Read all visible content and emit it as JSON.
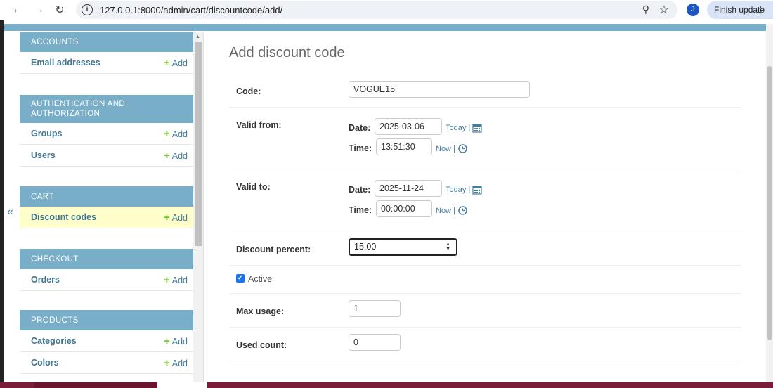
{
  "browser": {
    "url": "127.0.0.1:8000/admin/cart/discountcode/add/",
    "avatar_letter": "J",
    "finish_update_label": "Finish update"
  },
  "sidebar": {
    "toggle_label": "«",
    "modules": [
      {
        "name": "ACCOUNTS",
        "models": [
          {
            "label": "Email addresses",
            "add": "Add"
          }
        ]
      },
      {
        "name": "AUTHENTICATION AND AUTHORIZATION",
        "models": [
          {
            "label": "Groups",
            "add": "Add"
          },
          {
            "label": "Users",
            "add": "Add"
          }
        ]
      },
      {
        "name": "CART",
        "models": [
          {
            "label": "Discount codes",
            "add": "Add",
            "current": true
          }
        ]
      },
      {
        "name": "CHECKOUT",
        "models": [
          {
            "label": "Orders",
            "add": "Add"
          }
        ]
      },
      {
        "name": "PRODUCTS",
        "models": [
          {
            "label": "Categories",
            "add": "Add"
          },
          {
            "label": "Colors",
            "add": "Add"
          }
        ]
      }
    ]
  },
  "form": {
    "title": "Add discount code",
    "code": {
      "label": "Code:",
      "value": "VOGUE15"
    },
    "valid_from": {
      "label": "Valid from:",
      "date_label": "Date:",
      "date_value": "2025-03-06",
      "today": "Today |",
      "time_label": "Time:",
      "time_value": "13:51:30",
      "now": "Now |"
    },
    "valid_to": {
      "label": "Valid to:",
      "date_label": "Date:",
      "date_value": "2025-11-24",
      "today": "Today |",
      "time_label": "Time:",
      "time_value": "00:00:00",
      "now": "Now |"
    },
    "discount_percent": {
      "label": "Discount percent:",
      "value": "15.00"
    },
    "active": {
      "label": "Active",
      "checked": true
    },
    "max_usage": {
      "label": "Max usage:",
      "value": "1"
    },
    "used_count": {
      "label": "Used count:",
      "value": "0"
    }
  },
  "colors": {
    "header": "#79aec8",
    "link": "#447e9b",
    "add_plus": "#70bf2b",
    "current_row": "#ffffcc"
  }
}
